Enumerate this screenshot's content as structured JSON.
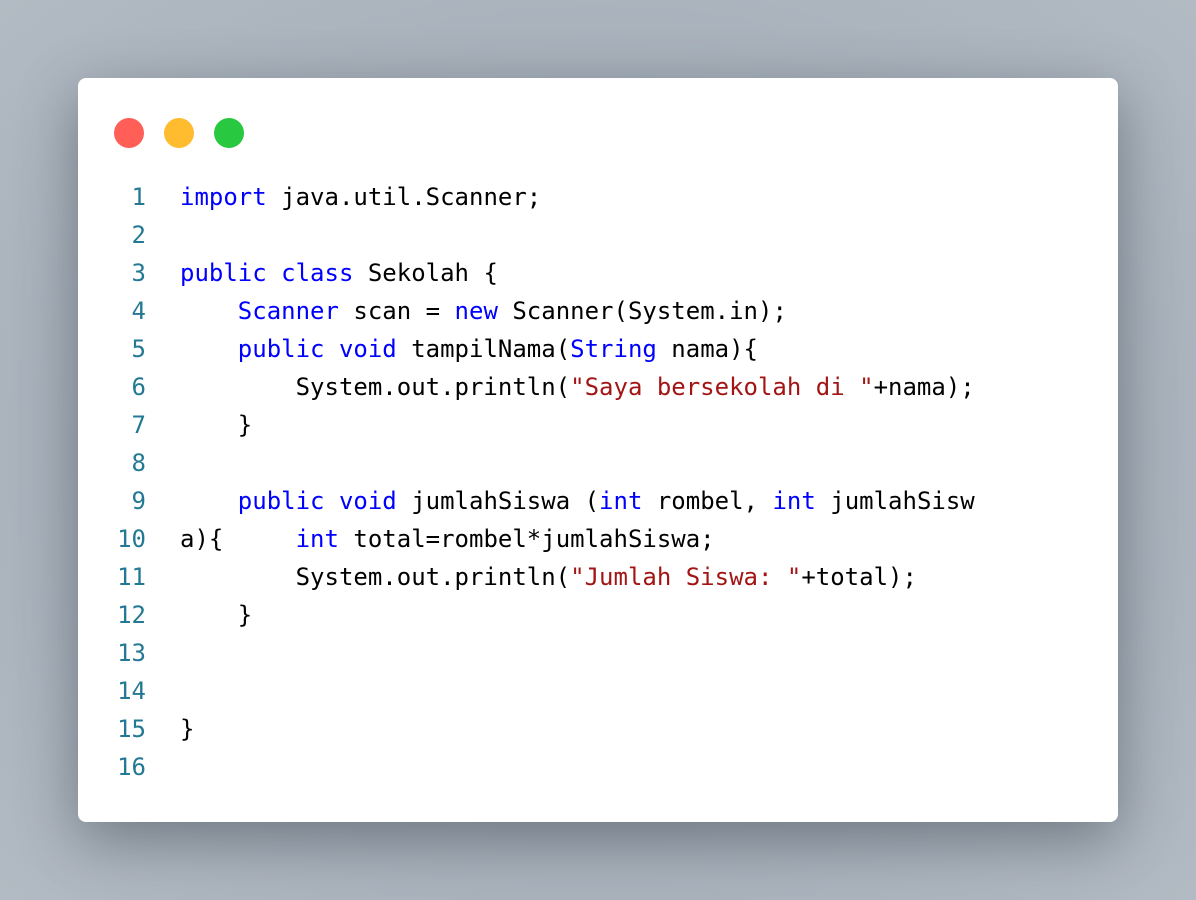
{
  "window": {
    "dots": [
      {
        "name": "close",
        "color": "#ff5f57"
      },
      {
        "name": "minimize",
        "color": "#febc2e"
      },
      {
        "name": "maximize",
        "color": "#28c840"
      }
    ]
  },
  "colors": {
    "keyword": "#0000ff",
    "string": "#a31515",
    "line_number": "#237893",
    "text": "#000000"
  },
  "code": {
    "lines": [
      {
        "n": "1",
        "tokens": [
          [
            "kw",
            "import"
          ],
          [
            "plain",
            " java.util.Scanner;"
          ]
        ]
      },
      {
        "n": "2",
        "tokens": []
      },
      {
        "n": "3",
        "tokens": [
          [
            "kw",
            "public"
          ],
          [
            "plain",
            " "
          ],
          [
            "kw",
            "class"
          ],
          [
            "plain",
            " Sekolah {"
          ]
        ]
      },
      {
        "n": "4",
        "tokens": [
          [
            "plain",
            "    "
          ],
          [
            "ty",
            "Scanner"
          ],
          [
            "plain",
            " scan = "
          ],
          [
            "kw",
            "new"
          ],
          [
            "plain",
            " Scanner(System.in);"
          ]
        ]
      },
      {
        "n": "5",
        "tokens": [
          [
            "plain",
            "    "
          ],
          [
            "kw",
            "public"
          ],
          [
            "plain",
            " "
          ],
          [
            "kw",
            "void"
          ],
          [
            "plain",
            " tampilNama("
          ],
          [
            "ty",
            "String"
          ],
          [
            "plain",
            " nama){"
          ]
        ]
      },
      {
        "n": "6",
        "tokens": [
          [
            "plain",
            "        System.out.println("
          ],
          [
            "str",
            "\"Saya bersekolah di \""
          ],
          [
            "plain",
            "+nama);"
          ]
        ]
      },
      {
        "n": "7",
        "tokens": [
          [
            "plain",
            "    }"
          ]
        ]
      },
      {
        "n": "8",
        "tokens": []
      },
      {
        "n": "9",
        "tokens": [
          [
            "plain",
            "    "
          ],
          [
            "kw",
            "public"
          ],
          [
            "plain",
            " "
          ],
          [
            "kw",
            "void"
          ],
          [
            "plain",
            " jumlahSiswa ("
          ],
          [
            "kw",
            "int"
          ],
          [
            "plain",
            " rombel, "
          ],
          [
            "kw",
            "int"
          ],
          [
            "plain",
            " jumlahSisw"
          ]
        ]
      },
      {
        "n": "10",
        "tokens": [
          [
            "plain",
            "a){     "
          ],
          [
            "kw",
            "int"
          ],
          [
            "plain",
            " total=rombel*jumlahSiswa;"
          ]
        ]
      },
      {
        "n": "11",
        "tokens": [
          [
            "plain",
            "        System.out.println("
          ],
          [
            "str",
            "\"Jumlah Siswa: \""
          ],
          [
            "plain",
            "+total);"
          ]
        ]
      },
      {
        "n": "12",
        "tokens": [
          [
            "plain",
            "    }"
          ]
        ]
      },
      {
        "n": "13",
        "tokens": []
      },
      {
        "n": "14",
        "tokens": []
      },
      {
        "n": "15",
        "tokens": [
          [
            "plain",
            "}"
          ]
        ]
      },
      {
        "n": "16",
        "tokens": []
      }
    ]
  }
}
